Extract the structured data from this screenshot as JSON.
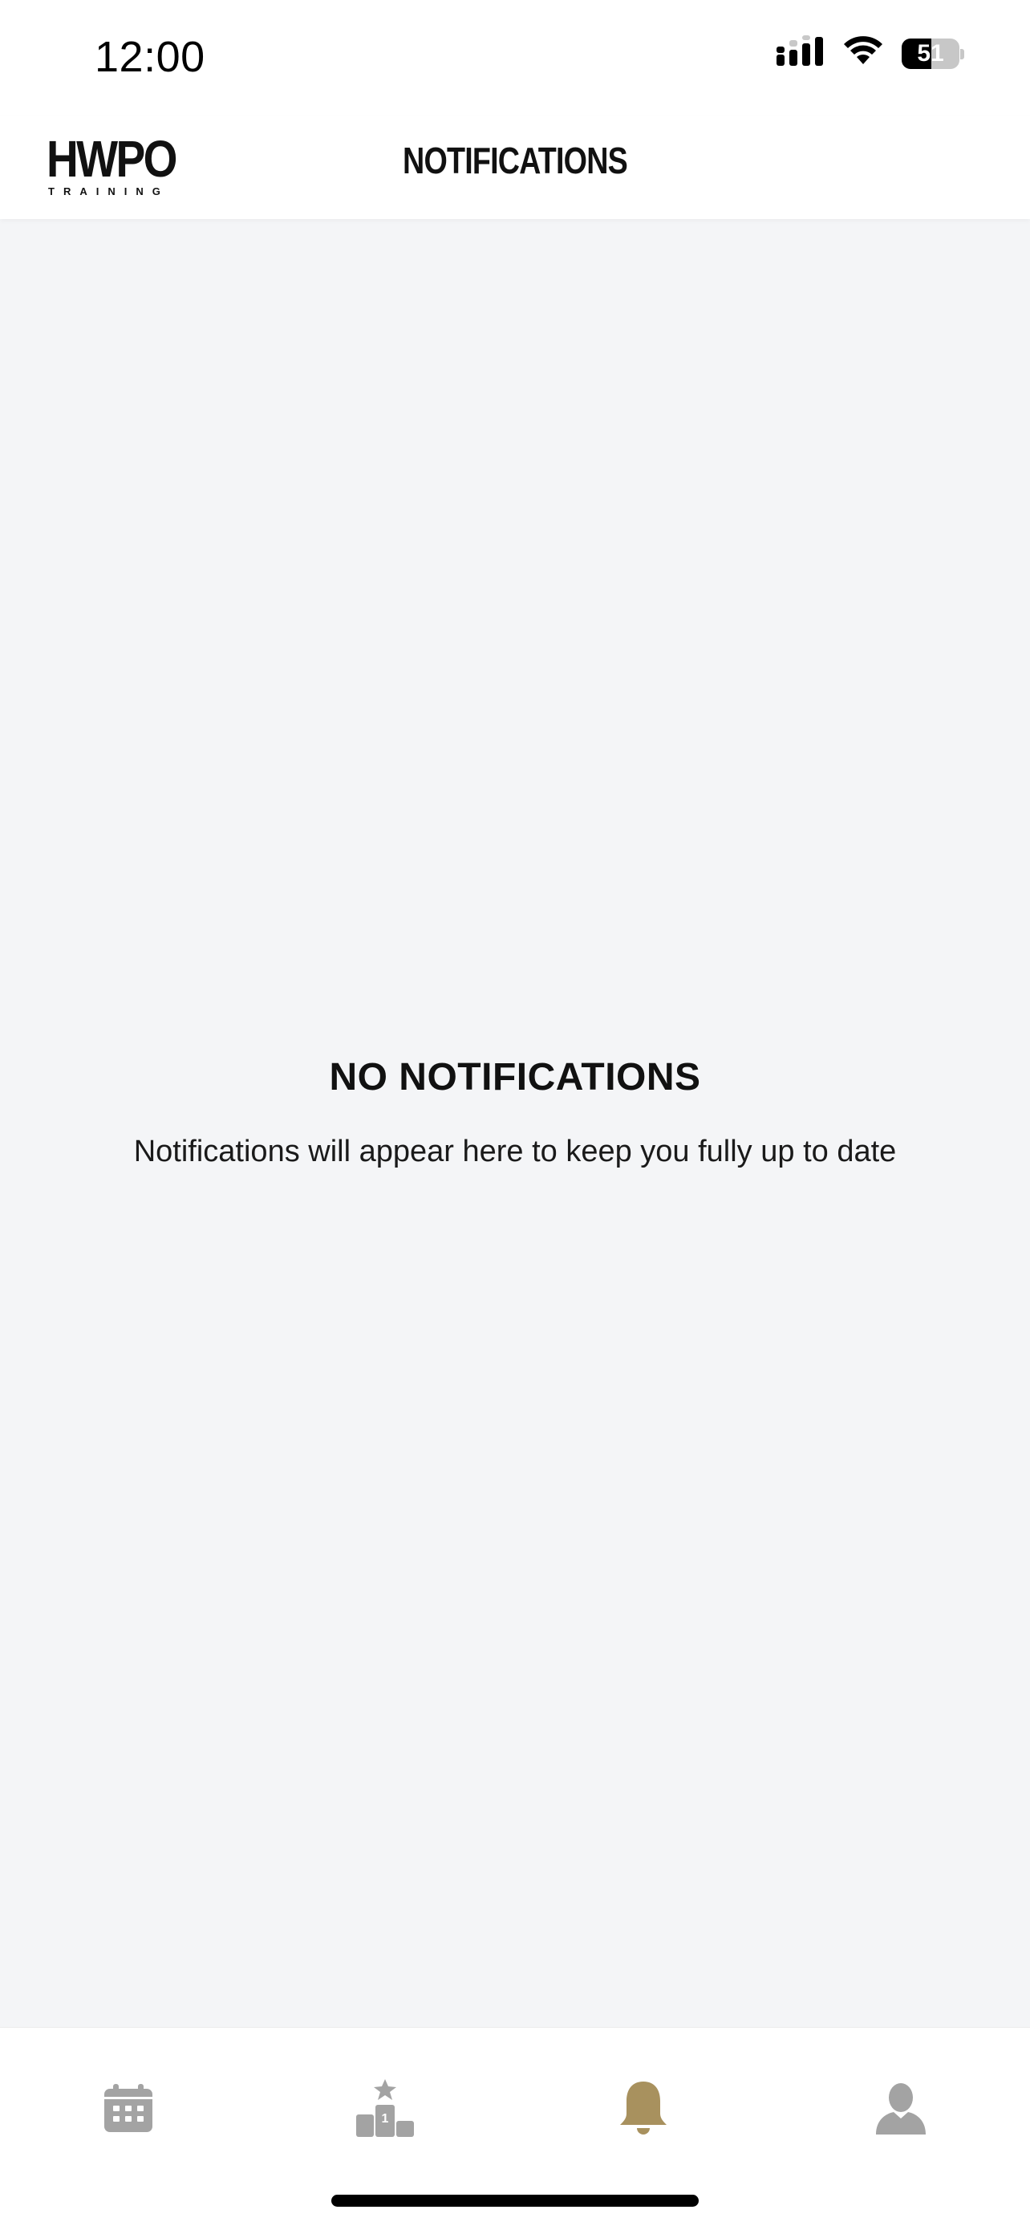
{
  "status_bar": {
    "time": "12:00",
    "battery_percent": "51",
    "battery_level": 0.51
  },
  "header": {
    "logo_main": "HWPO",
    "logo_sub": "TRAINING",
    "title": "NOTIFICATIONS"
  },
  "empty_state": {
    "title": "NO NOTIFICATIONS",
    "message": "Notifications will appear here to keep you fully up to date"
  },
  "tab_bar": {
    "active_tab": "notifications",
    "tabs": [
      {
        "id": "calendar",
        "icon": "calendar-icon"
      },
      {
        "id": "leaderboard",
        "icon": "podium-icon"
      },
      {
        "id": "notifications",
        "icon": "bell-icon"
      },
      {
        "id": "profile",
        "icon": "person-icon"
      }
    ]
  },
  "colors": {
    "active_tab": "#a8915e",
    "inactive_tab": "#a3a3a3",
    "background": "#f4f5f7",
    "surface": "#ffffff",
    "text": "#111111"
  }
}
